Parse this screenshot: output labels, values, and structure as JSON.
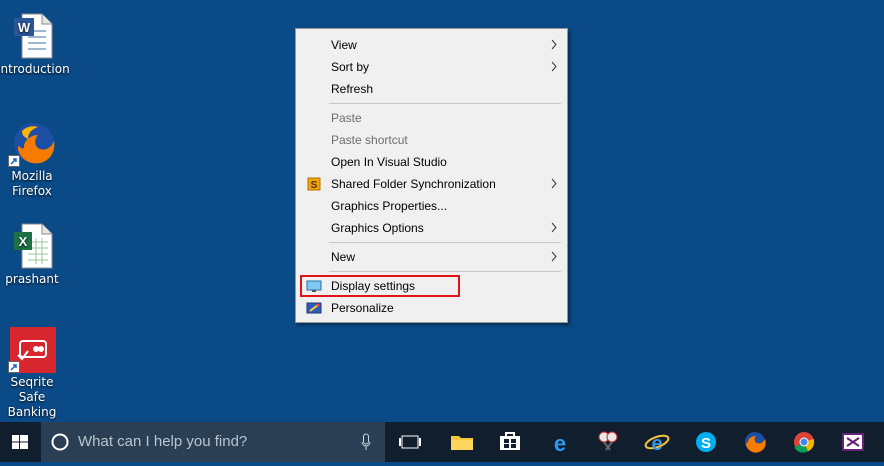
{
  "desktop": {
    "icons": [
      {
        "label": "Introduction",
        "icon": "word-document-icon"
      },
      {
        "label": "Mozilla Firefox",
        "icon": "firefox-icon"
      },
      {
        "label": "prashant",
        "icon": "excel-document-icon"
      },
      {
        "label": "Seqrite Safe Banking",
        "icon": "seqrite-icon"
      }
    ]
  },
  "context_menu": {
    "items": [
      {
        "label": "View",
        "submenu": true,
        "disabled": false
      },
      {
        "label": "Sort by",
        "submenu": true,
        "disabled": false
      },
      {
        "label": "Refresh",
        "submenu": false,
        "disabled": false
      },
      {
        "label": "Paste",
        "submenu": false,
        "disabled": true
      },
      {
        "label": "Paste shortcut",
        "submenu": false,
        "disabled": true
      },
      {
        "label": "Open In Visual Studio",
        "submenu": false,
        "disabled": false
      },
      {
        "label": "Shared Folder Synchronization",
        "submenu": true,
        "disabled": false,
        "icon": "sync-folder-icon"
      },
      {
        "label": "Graphics Properties...",
        "submenu": false,
        "disabled": false
      },
      {
        "label": "Graphics Options",
        "submenu": true,
        "disabled": false
      },
      {
        "label": "New",
        "submenu": true,
        "disabled": false
      },
      {
        "label": "Display settings",
        "submenu": false,
        "disabled": false,
        "icon": "display-icon",
        "highlighted": true
      },
      {
        "label": "Personalize",
        "submenu": false,
        "disabled": false,
        "icon": "personalize-icon"
      }
    ],
    "highlight_color": "#e0141b"
  },
  "taskbar": {
    "search_placeholder": "What can I help you find?",
    "pinned": [
      "task-view-icon",
      "file-explorer-icon",
      "store-icon",
      "edge-icon",
      "snipping-tool-icon",
      "internet-explorer-icon",
      "skype-icon",
      "firefox-icon",
      "chrome-icon",
      "visual-studio-icon"
    ]
  },
  "colors": {
    "desktop_bg": "#0a4a86",
    "taskbar_bg": "#101e2e",
    "menu_bg": "#f0f0f0"
  }
}
